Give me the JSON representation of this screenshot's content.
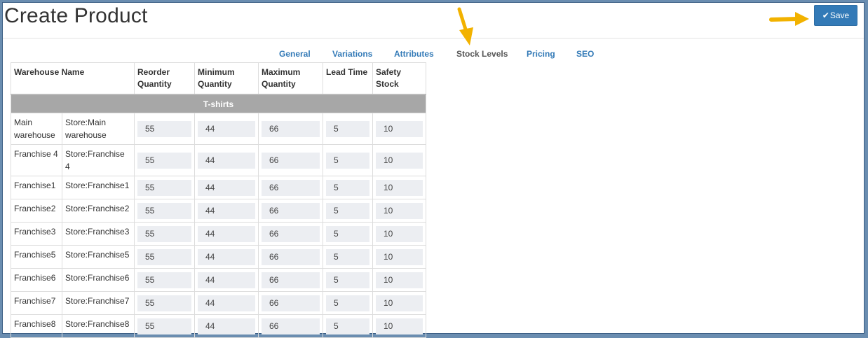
{
  "header": {
    "title": "Create Product",
    "save_label": "Save",
    "save_icon": "check-icon"
  },
  "tabs": [
    {
      "label": "General",
      "active": false
    },
    {
      "label": "Variations",
      "active": false
    },
    {
      "label": "Attributes",
      "active": false
    },
    {
      "label": "Stock Levels",
      "active": true
    },
    {
      "label": "Pricing",
      "active": false
    },
    {
      "label": "SEO",
      "active": false
    }
  ],
  "table": {
    "headers": [
      "Warehouse Name",
      "Reorder Quantity",
      "Minimum Quantity",
      "Maximum Quantity",
      "Lead Time",
      "Safety Stock"
    ],
    "group": "T-shirts",
    "rows": [
      {
        "warehouse": "Main warehouse",
        "store": "Store:Main warehouse",
        "reorder": "55",
        "minimum": "44",
        "maximum": "66",
        "lead": "5",
        "safety": "10"
      },
      {
        "warehouse": "Franchise 4",
        "store": "Store:Franchise 4",
        "reorder": "55",
        "minimum": "44",
        "maximum": "66",
        "lead": "5",
        "safety": "10"
      },
      {
        "warehouse": "Franchise1",
        "store": "Store:Franchise1",
        "reorder": "55",
        "minimum": "44",
        "maximum": "66",
        "lead": "5",
        "safety": "10"
      },
      {
        "warehouse": "Franchise2",
        "store": "Store:Franchise2",
        "reorder": "55",
        "minimum": "44",
        "maximum": "66",
        "lead": "5",
        "safety": "10"
      },
      {
        "warehouse": "Franchise3",
        "store": "Store:Franchise3",
        "reorder": "55",
        "minimum": "44",
        "maximum": "66",
        "lead": "5",
        "safety": "10"
      },
      {
        "warehouse": "Franchise5",
        "store": "Store:Franchise5",
        "reorder": "55",
        "minimum": "44",
        "maximum": "66",
        "lead": "5",
        "safety": "10"
      },
      {
        "warehouse": "Franchise6",
        "store": "Store:Franchise6",
        "reorder": "55",
        "minimum": "44",
        "maximum": "66",
        "lead": "5",
        "safety": "10"
      },
      {
        "warehouse": "Franchise7",
        "store": "Store:Franchise7",
        "reorder": "55",
        "minimum": "44",
        "maximum": "66",
        "lead": "5",
        "safety": "10"
      },
      {
        "warehouse": "Franchise8",
        "store": "Store:Franchise8",
        "reorder": "55",
        "minimum": "44",
        "maximum": "66",
        "lead": "5",
        "safety": "10"
      }
    ]
  },
  "colors": {
    "accent": "#337ab7",
    "annotation_arrow": "#f2b200",
    "group_row": "#a7a7a7",
    "input_bg": "#eceef2"
  }
}
